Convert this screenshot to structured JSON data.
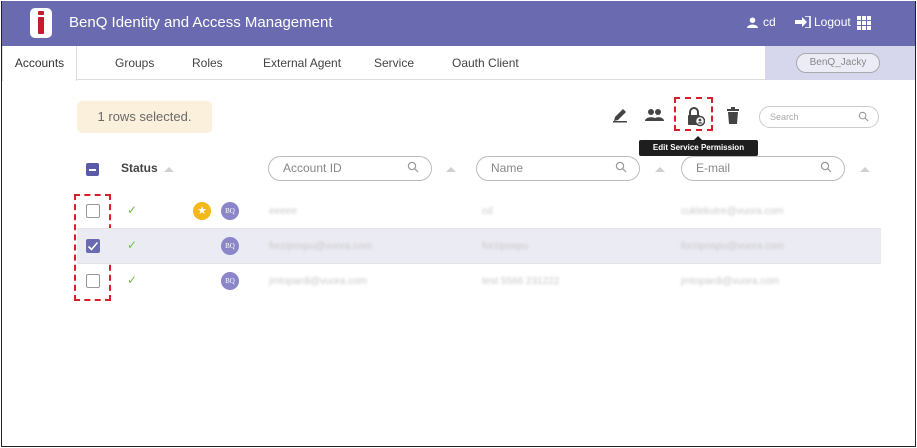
{
  "header": {
    "app_title": "BenQ Identity and Access Management",
    "user_name": "cd",
    "logout_label": "Logout"
  },
  "tabs": [
    "Accounts",
    "Groups",
    "Roles",
    "External Agent",
    "Service",
    "Oauth Client"
  ],
  "active_tab": "Accounts",
  "org_selector": "BenQ_Jacky",
  "toolbar": {
    "selection_text": "1 rows selected.",
    "search_placeholder": "Search",
    "tooltip": "Edit Service Permission",
    "icons": [
      "edit-icon",
      "group-icon",
      "lock-user-icon",
      "trash-icon"
    ]
  },
  "table": {
    "status_header": "Status",
    "filters": {
      "account_id": "Account ID",
      "name": "Name",
      "email": "E-mail"
    },
    "rows": [
      {
        "checked": false,
        "status": "✓",
        "starred": true,
        "badge": "BQ",
        "account_id": "eeeee",
        "name": "cd",
        "email": "cuklekutre@vuora.com"
      },
      {
        "checked": true,
        "status": "✓",
        "starred": false,
        "badge": "BQ",
        "account_id": "forzipospu@vuora.com",
        "name": "forzipospu",
        "email": "forzipospu@vuora.com"
      },
      {
        "checked": false,
        "status": "✓",
        "starred": false,
        "badge": "BQ",
        "account_id": "jmtopardi@vuora.com",
        "name": "test 5566 231222",
        "email": "jmtopardi@vuora.com"
      }
    ]
  },
  "colors": {
    "header_bg": "#6a6ab0",
    "highlight": "#d8202a",
    "selection_bg": "#faf0dc",
    "check_green": "#6cbf4b",
    "badge": "#8b85c9",
    "star": "#f4b81a"
  }
}
